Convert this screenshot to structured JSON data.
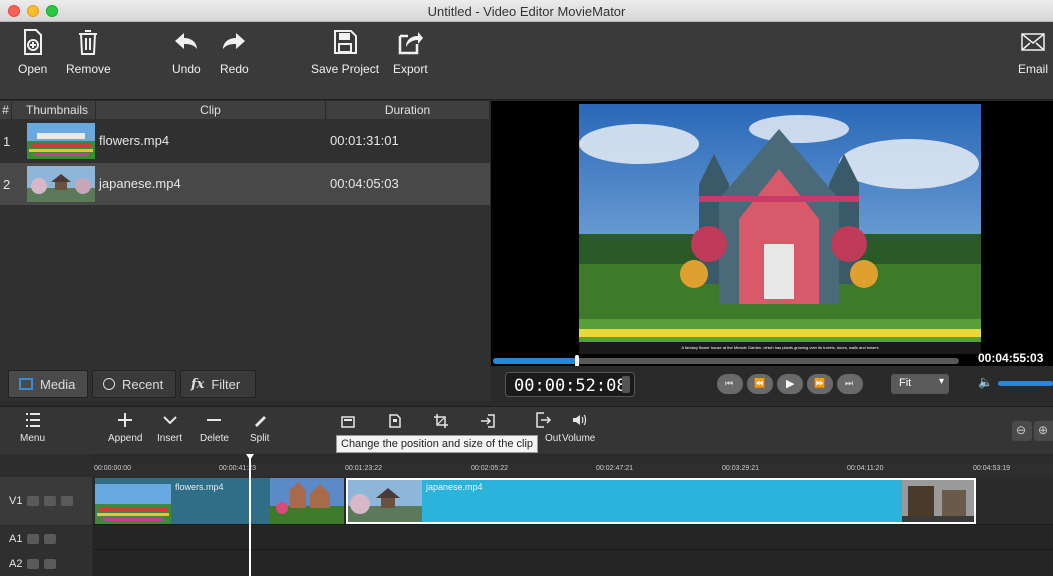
{
  "window": {
    "title": "Untitled - Video Editor MovieMator"
  },
  "toolbar": {
    "open": "Open",
    "remove": "Remove",
    "undo": "Undo",
    "redo": "Redo",
    "save_project": "Save Project",
    "export": "Export",
    "email": "Email"
  },
  "media": {
    "headers": {
      "num": "#",
      "thumbnails": "Thumbnails",
      "clip": "Clip",
      "duration": "Duration"
    },
    "rows": [
      {
        "num": "1",
        "clip": "flowers.mp4",
        "duration": "00:01:31:01"
      },
      {
        "num": "2",
        "clip": "japanese.mp4",
        "duration": "00:04:05:03"
      }
    ],
    "tabs": {
      "media": "Media",
      "recent": "Recent",
      "filter": "Filter",
      "filter_prefix": "fx"
    }
  },
  "preview": {
    "subtitle": "A fantasy flower house at the Miracle Garden, which has plants growing over its turrets, doors, walls and towers",
    "total_time": "00:04:55:03",
    "current_time": "00:00:52:08",
    "position_fraction": 0.18,
    "zoom_option": "Fit",
    "volume_fraction": 1.0
  },
  "timeline": {
    "buttons": {
      "menu": "Menu",
      "append": "Append",
      "insert": "Insert",
      "delete": "Delete",
      "split": "Split",
      "out": "Out",
      "volume": "Volume"
    },
    "tooltip": "Change the position and size of the clip",
    "ticks": [
      "00:00:00:00",
      "00:00:41:23",
      "00:01:23:22",
      "00:02:05:22",
      "00:02:47:21",
      "00:03:29:21",
      "00:04:11:20",
      "00:04:53:19"
    ],
    "tracks": {
      "v1": "V1",
      "a1": "A1",
      "a2": "A2"
    },
    "clips": {
      "flowers": "flowers.mp4",
      "japanese": "japanese.mp4"
    }
  },
  "colors": {
    "accent": "#2a86d8",
    "clip_flowers": "#2f6e86",
    "clip_japanese": "#2bb3dc"
  }
}
